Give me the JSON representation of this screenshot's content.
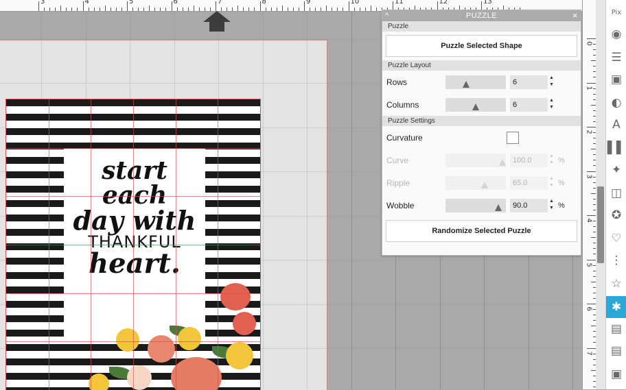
{
  "ruler_top": {
    "labels": [
      "3",
      "4",
      "5",
      "6",
      "7",
      "8",
      "9",
      "10",
      "11",
      "12",
      "13"
    ]
  },
  "ruler_side": {
    "labels": [
      "0",
      "1",
      "2",
      "3",
      "4",
      "5",
      "6",
      "7"
    ]
  },
  "artwork": {
    "lines": [
      "start",
      "each",
      "day with",
      "THANKFUL",
      "heart."
    ]
  },
  "panel": {
    "title": "PUZZLE",
    "sections": {
      "puzzle": "Puzzle",
      "layout": "Puzzle Layout",
      "settings": "Puzzle Settings"
    },
    "puzzle_selected_label": "Puzzle Selected Shape",
    "rows": {
      "label": "Rows",
      "value": "6"
    },
    "columns": {
      "label": "Columns",
      "value": "6"
    },
    "curvature": {
      "label": "Curvature",
      "checked": false
    },
    "curve": {
      "label": "Curve",
      "value": "100.0",
      "unit": "%"
    },
    "ripple": {
      "label": "Ripple",
      "value": "65.0",
      "unit": "%"
    },
    "wobble": {
      "label": "Wobble",
      "value": "90.0",
      "unit": "%"
    },
    "randomize_label": "Randomize Selected Puzzle"
  },
  "toolbar": {
    "icons": [
      "pixscan-icon",
      "fill-palette-icon",
      "line-style-icon",
      "image-effects-icon",
      "transparency-icon",
      "text-style-icon",
      "align-icon",
      "replicate-icon",
      "modify-icon",
      "offset-star-icon",
      "trace-icon",
      "dots-icon",
      "star-icon",
      "puzzle-icon",
      "page-setup-icon",
      "hatch-icon",
      "send-icon"
    ]
  },
  "colors": {
    "accent": "#29a8d8",
    "cut_line": "#d9534f"
  }
}
